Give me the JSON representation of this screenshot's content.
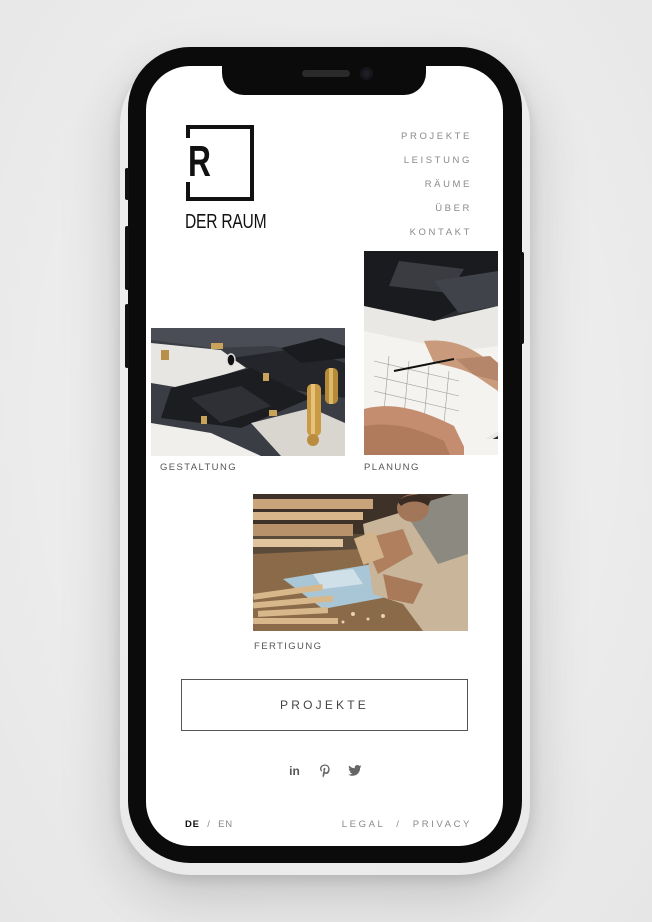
{
  "brand": {
    "logo_text": "DER RAUM",
    "logo_glyph": "R"
  },
  "nav": [
    {
      "label": "PROJEKTE"
    },
    {
      "label": "LEISTUNG"
    },
    {
      "label": "RÄUME"
    },
    {
      "label": "ÜBER"
    },
    {
      "label": "KONTAKT"
    }
  ],
  "tiles": {
    "gestaltung": "GESTALTUNG",
    "planung": "PLANUNG",
    "fertigung": "FERTIGUNG"
  },
  "cta_label": "PROJEKTE",
  "social": [
    "linkedin-icon",
    "pinterest-icon",
    "twitter-icon"
  ],
  "social_text": {
    "linkedin": "in"
  },
  "footer": {
    "lang_active": "DE",
    "lang_sep": "/",
    "lang_other": "EN",
    "legal": "LEGAL",
    "sep": "/",
    "privacy": "PRIVACY"
  },
  "colors": {
    "text_dark": "#111111",
    "text_muted": "#8a8a8a",
    "frame": "#0b0b0b"
  }
}
